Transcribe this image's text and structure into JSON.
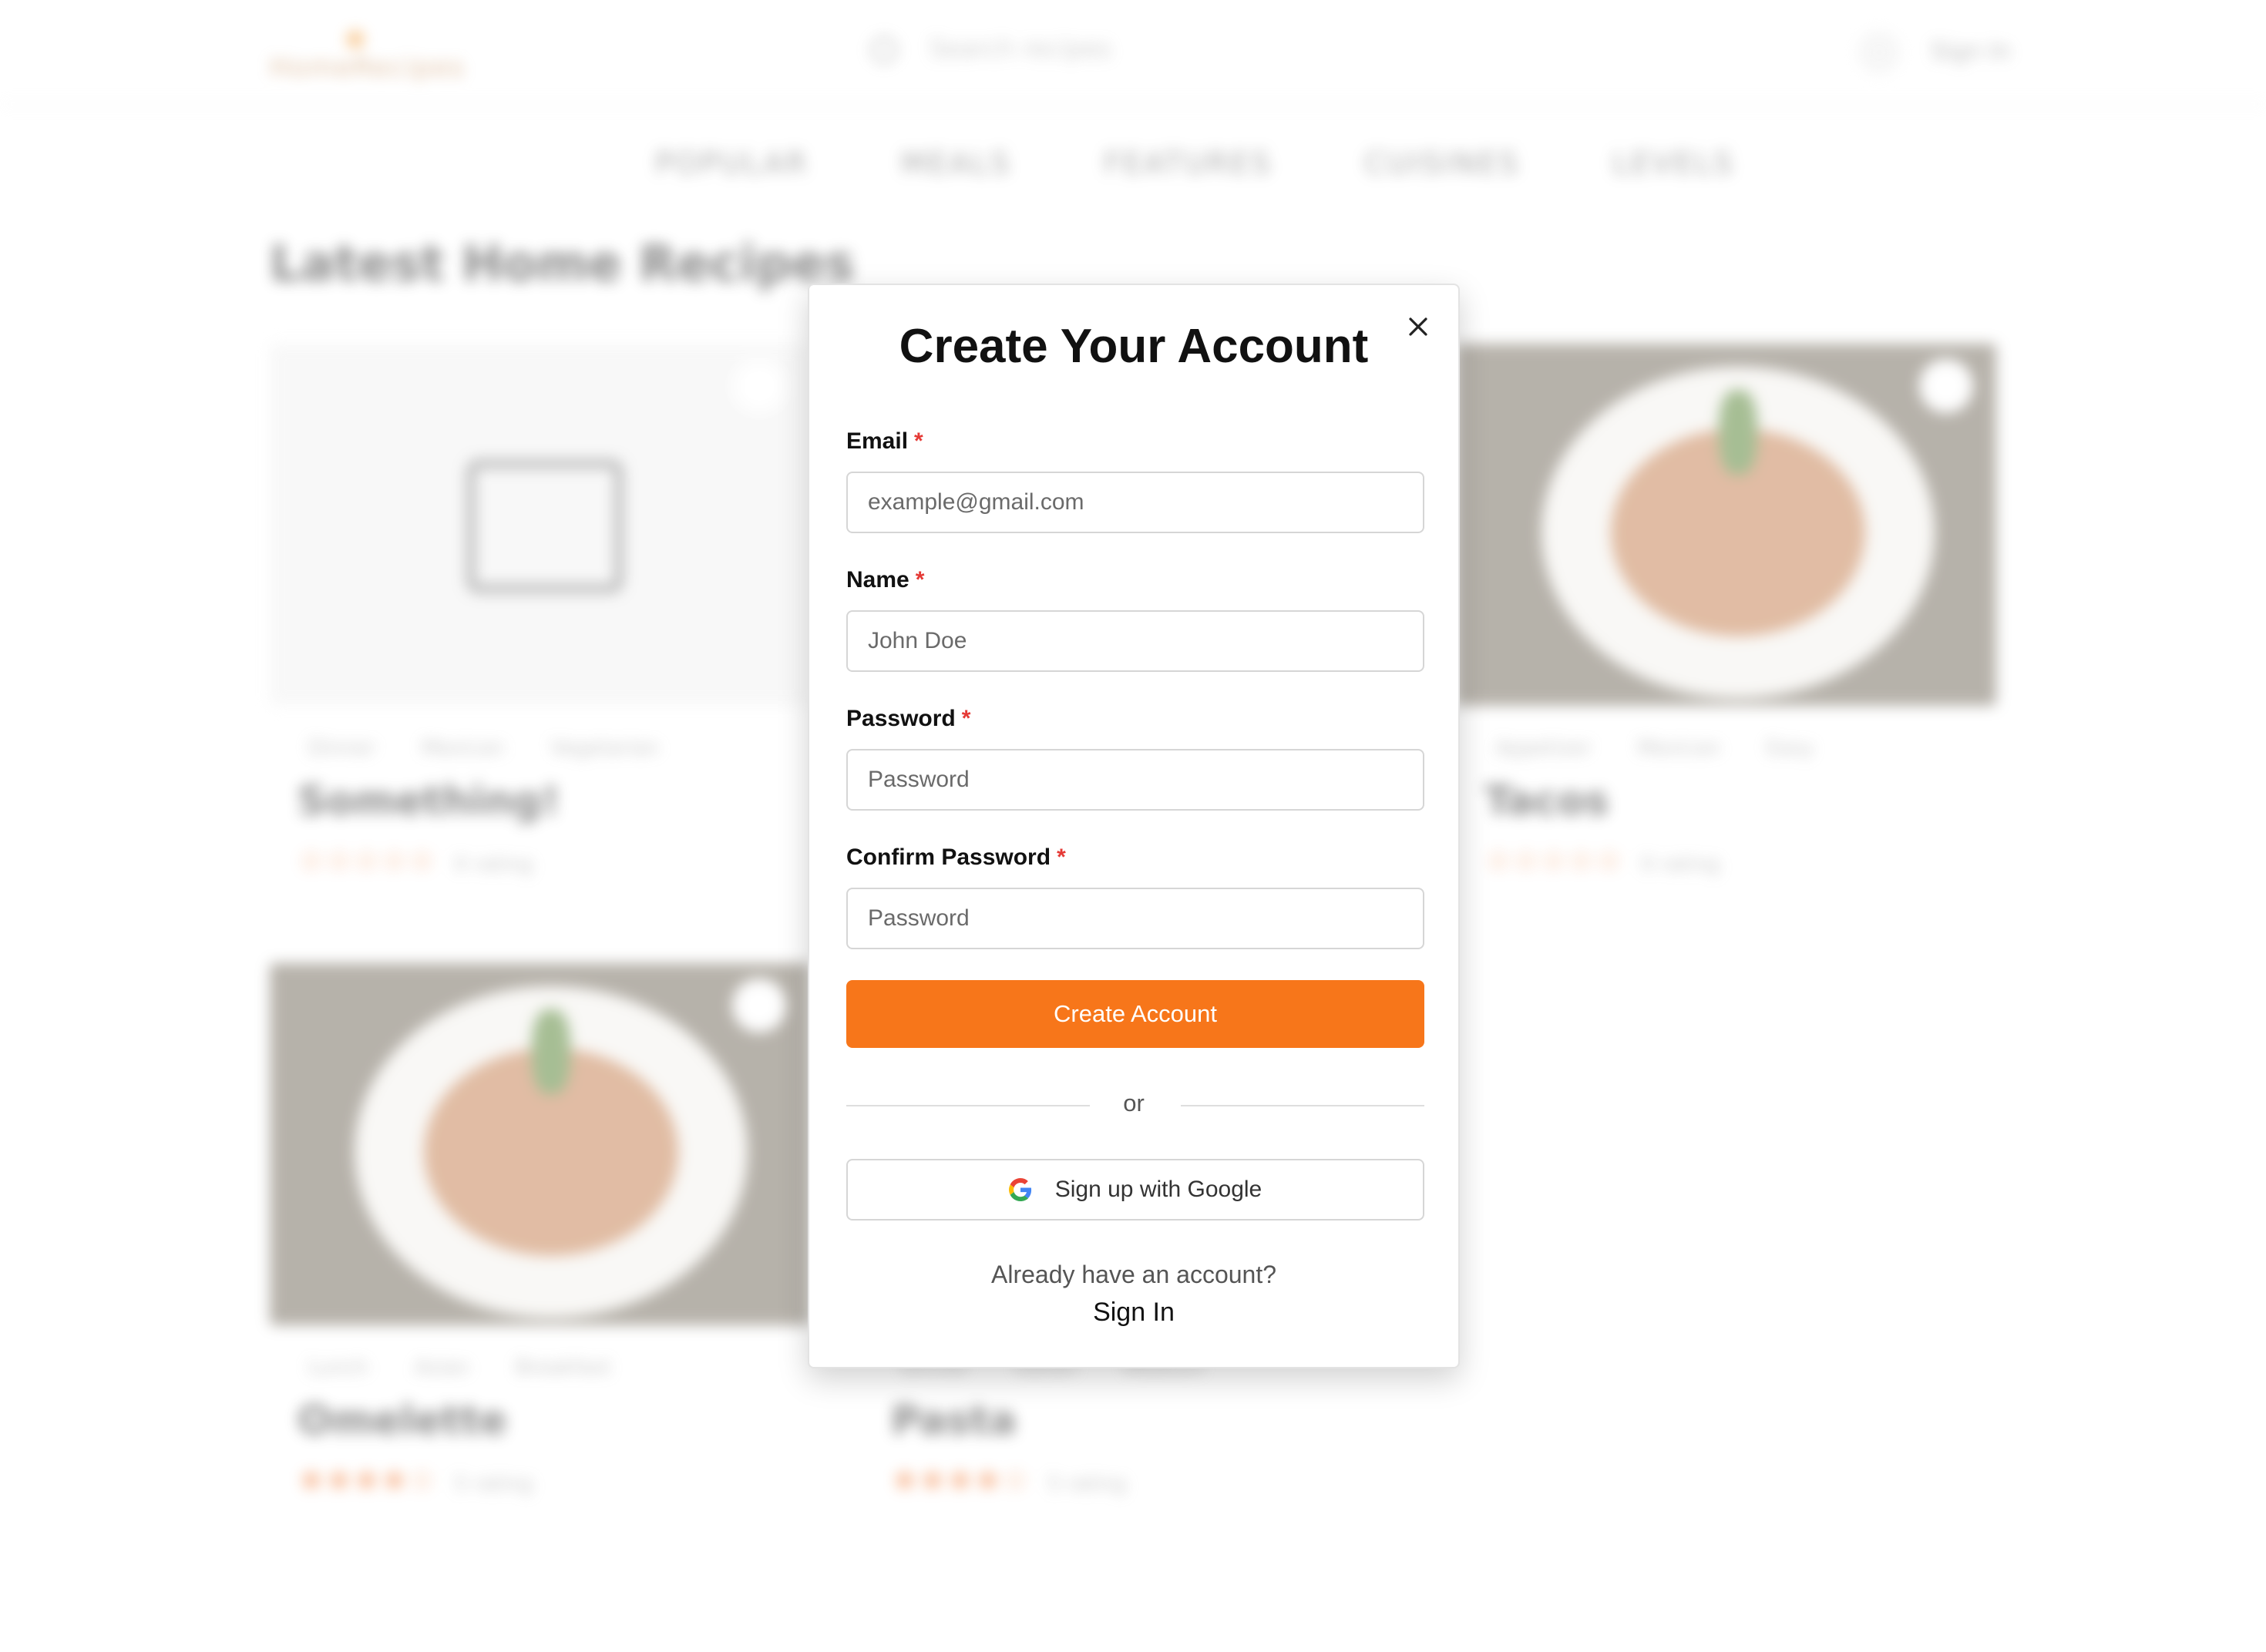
{
  "background": {
    "logo_text": "HomeRecipes",
    "search_placeholder": "Search recipes",
    "sign_in": "Sign In",
    "nav": [
      "POPULAR",
      "MEALS",
      "FEATURES",
      "CUISINES",
      "LEVELS"
    ],
    "heading": "Latest Home Recipes",
    "cards": [
      {
        "title": "Something!",
        "tags": [
          "Dinner",
          "Mexican",
          "Vegetarian"
        ],
        "rating_text": "0 rating",
        "stars": "☆☆☆☆☆"
      },
      {
        "title": "Tacos",
        "tags": [
          "Appetizer",
          "Mexican",
          "Easy"
        ],
        "rating_text": "0 rating",
        "stars": "☆☆☆☆☆"
      },
      {
        "title": "Omelette",
        "tags": [
          "Lunch",
          "Asian",
          "Breakfast"
        ],
        "rating_text": "5 rating",
        "stars": "★★★★☆"
      },
      {
        "title": "Pasta",
        "tags": [
          "Dinner",
          "Italian",
          "Medium"
        ],
        "rating_text": "5 rating",
        "stars": "★★★★☆"
      }
    ]
  },
  "modal": {
    "title": "Create Your Account",
    "required_mark": "*",
    "fields": {
      "email": {
        "label": "Email",
        "placeholder": "example@gmail.com"
      },
      "name": {
        "label": "Name",
        "placeholder": "John Doe"
      },
      "password": {
        "label": "Password",
        "placeholder": "Password"
      },
      "confirm": {
        "label": "Confirm Password",
        "placeholder": "Password"
      }
    },
    "create_button": "Create Account",
    "divider_text": "or",
    "google_button": "Sign up with Google",
    "footer_question": "Already have an account?",
    "footer_link": "Sign In"
  },
  "colors": {
    "accent": "#f7761a",
    "required": "#e53935"
  },
  "icons": {
    "close": "close-icon",
    "google": "google-icon"
  }
}
